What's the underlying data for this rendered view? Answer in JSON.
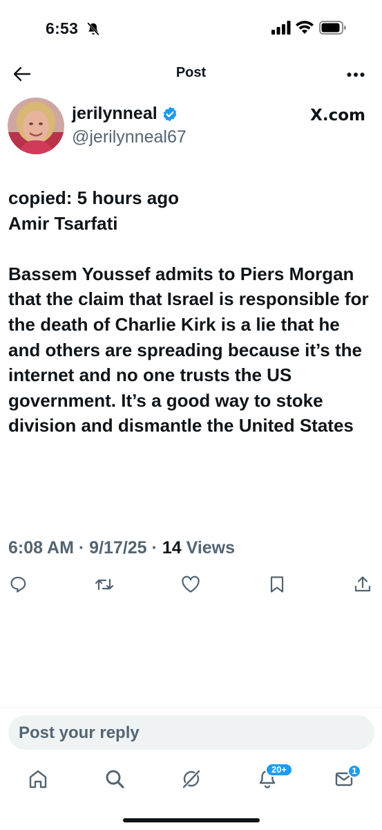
{
  "status_bar": {
    "time": "6:53"
  },
  "nav": {
    "title": "Post"
  },
  "author": {
    "display_name": "jerilynneal",
    "handle": "@jerilynneal67",
    "source": "X.com"
  },
  "post": {
    "line1": "copied: 5 hours ago",
    "line2": "Amir Tsarfati",
    "paragraph": "Bassem Youssef admits to Piers Morgan that the claim that Israel is responsible for the death of Charlie Kirk is a lie that he and others are spreading because it’s the internet and no one trusts the US government. It’s a good way to stoke division and dismantle the United States"
  },
  "meta": {
    "time": "6:08 AM",
    "date": "9/17/25",
    "views_count": "14",
    "views_label": "Views",
    "separator": "·"
  },
  "reply": {
    "placeholder": "Post your reply"
  },
  "tabs": {
    "notifications_badge": "20+",
    "messages_badge": "1"
  },
  "colors": {
    "accent": "#1d9bf0",
    "text": "#0f1419",
    "secondary": "#536471"
  }
}
